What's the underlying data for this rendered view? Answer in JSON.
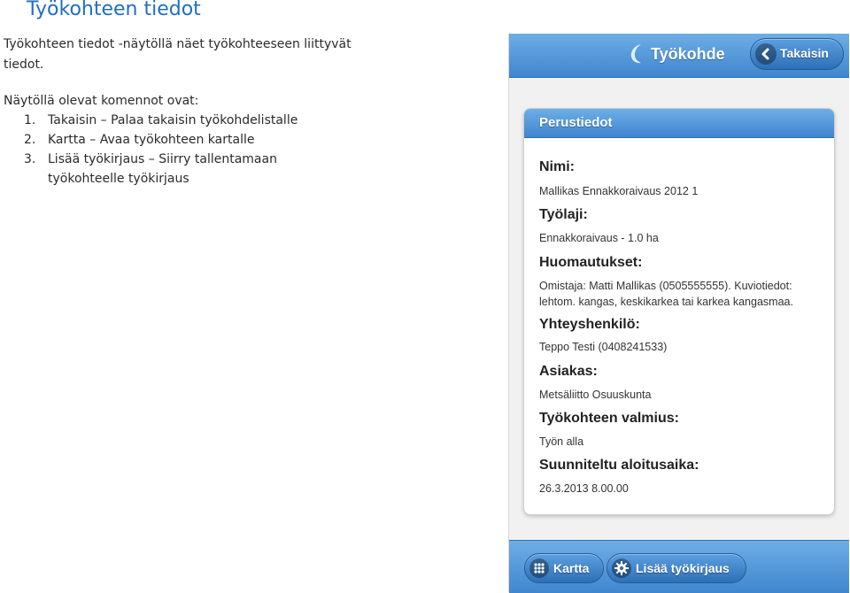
{
  "document": {
    "title": "Työkohteen tiedot",
    "intro": "Työkohteen tiedot -näytöllä näet työkohteeseen liittyvät tiedot.",
    "commands_heading": "Näytöllä olevat komennot ovat:",
    "commands": [
      {
        "num": "1.",
        "text": "Takaisin – Palaa takaisin työkohdelistalle"
      },
      {
        "num": "2.",
        "text": "Kartta – Avaa työkohteen kartalle"
      },
      {
        "num": "3.",
        "text": "Lisää työkirjaus – Siirry tallentamaan työkohteelle työkirjaus"
      }
    ]
  },
  "app": {
    "title": "Työkohde",
    "back_label": "Takaisin",
    "accent_color": "#3f86cf",
    "card": {
      "title": "Perustiedot",
      "fields": [
        {
          "label": "Nimi:",
          "value": "Mallikas Ennakkoraivaus 2012 1"
        },
        {
          "label": "Työlaji:",
          "value": "Ennakkoraivaus - 1.0 ha"
        },
        {
          "label": "Huomautukset:",
          "value": "Omistaja: Matti Mallikas (0505555555). Kuviotiedot: lehtom. kangas, keskikarkea tai karkea kangasmaa."
        },
        {
          "label": "Yhteyshenkilö:",
          "value": "Teppo Testi (0408241533)"
        },
        {
          "label": "Asiakas:",
          "value": "Metsäliitto Osuuskunta"
        },
        {
          "label": "Työkohteen valmius:",
          "value": "Työn alla"
        },
        {
          "label": "Suunniteltu aloitusaika:",
          "value": "26.3.2013 8.00.00"
        }
      ]
    },
    "footer": {
      "map_label": "Kartta",
      "add_log_label": "Lisää työkirjaus"
    }
  }
}
